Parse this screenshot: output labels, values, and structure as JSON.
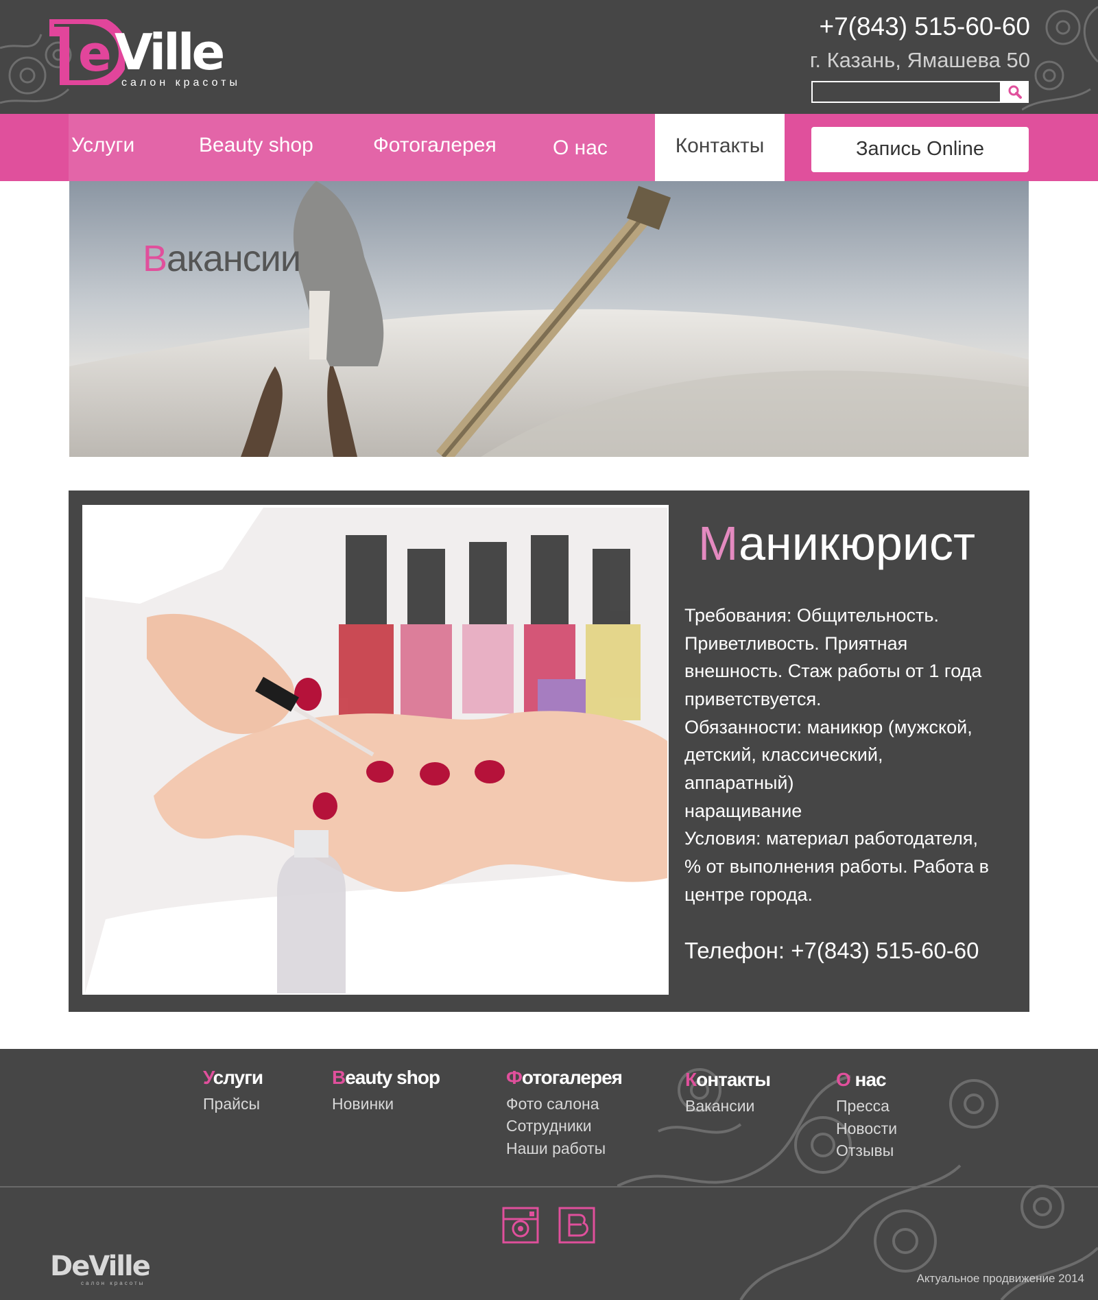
{
  "brand": {
    "logo_first": "De",
    "logo_second": "Ville",
    "tagline": "салон красоты"
  },
  "header": {
    "phone": "+7(843) 515-60-60",
    "address": "г. Казань, Ямашева 50",
    "search": {
      "value": "",
      "placeholder": ""
    }
  },
  "nav": {
    "items": [
      "Услуги",
      "Beauty shop",
      "Фотогалерея",
      "О нас",
      "Контакты"
    ],
    "active": "Контакты",
    "booking_label": "Запись Online"
  },
  "banner": {
    "title_first": "В",
    "title_rest": "акансии"
  },
  "vacancy": {
    "title_first": "М",
    "title_rest": "аникюрист",
    "lines": [
      " Требования: Общительность.",
      "Приветливость. Приятная",
      "внешность. Стаж работы от 1 года",
      "приветствуется.",
      "Обязанности: маникюр (мужской,",
      "детский, классический,",
      "аппаратный)",
      "наращивание",
      "Условия: материал работодателя,",
      "% от выполнения работы. Работа в",
      "центре города."
    ],
    "phone": "Телефон: +7(843) 515-60-60"
  },
  "footer": {
    "columns": [
      {
        "head_first": "У",
        "head_rest": "слуги",
        "links": [
          "Прайсы"
        ]
      },
      {
        "head_first": "B",
        "head_rest": "eauty shop",
        "links": [
          "Новинки"
        ]
      },
      {
        "head_first": "Ф",
        "head_rest": "отогалерея",
        "links": [
          "Фото салона",
          "Сотрудники",
          "Наши работы"
        ]
      },
      {
        "head_first": "К",
        "head_rest": "онтакты",
        "links": [
          "Вакансии"
        ]
      },
      {
        "head_first": "О",
        "head_rest": " нас",
        "links": [
          "Пресса",
          "Новости",
          "Отзывы"
        ]
      }
    ],
    "social_icons": [
      "instagram-icon",
      "vk-icon"
    ],
    "copyright": "Актуальное продвижение 2014"
  },
  "colors": {
    "accent": "#e0509c",
    "dark": "#464646",
    "white": "#ffffff"
  }
}
